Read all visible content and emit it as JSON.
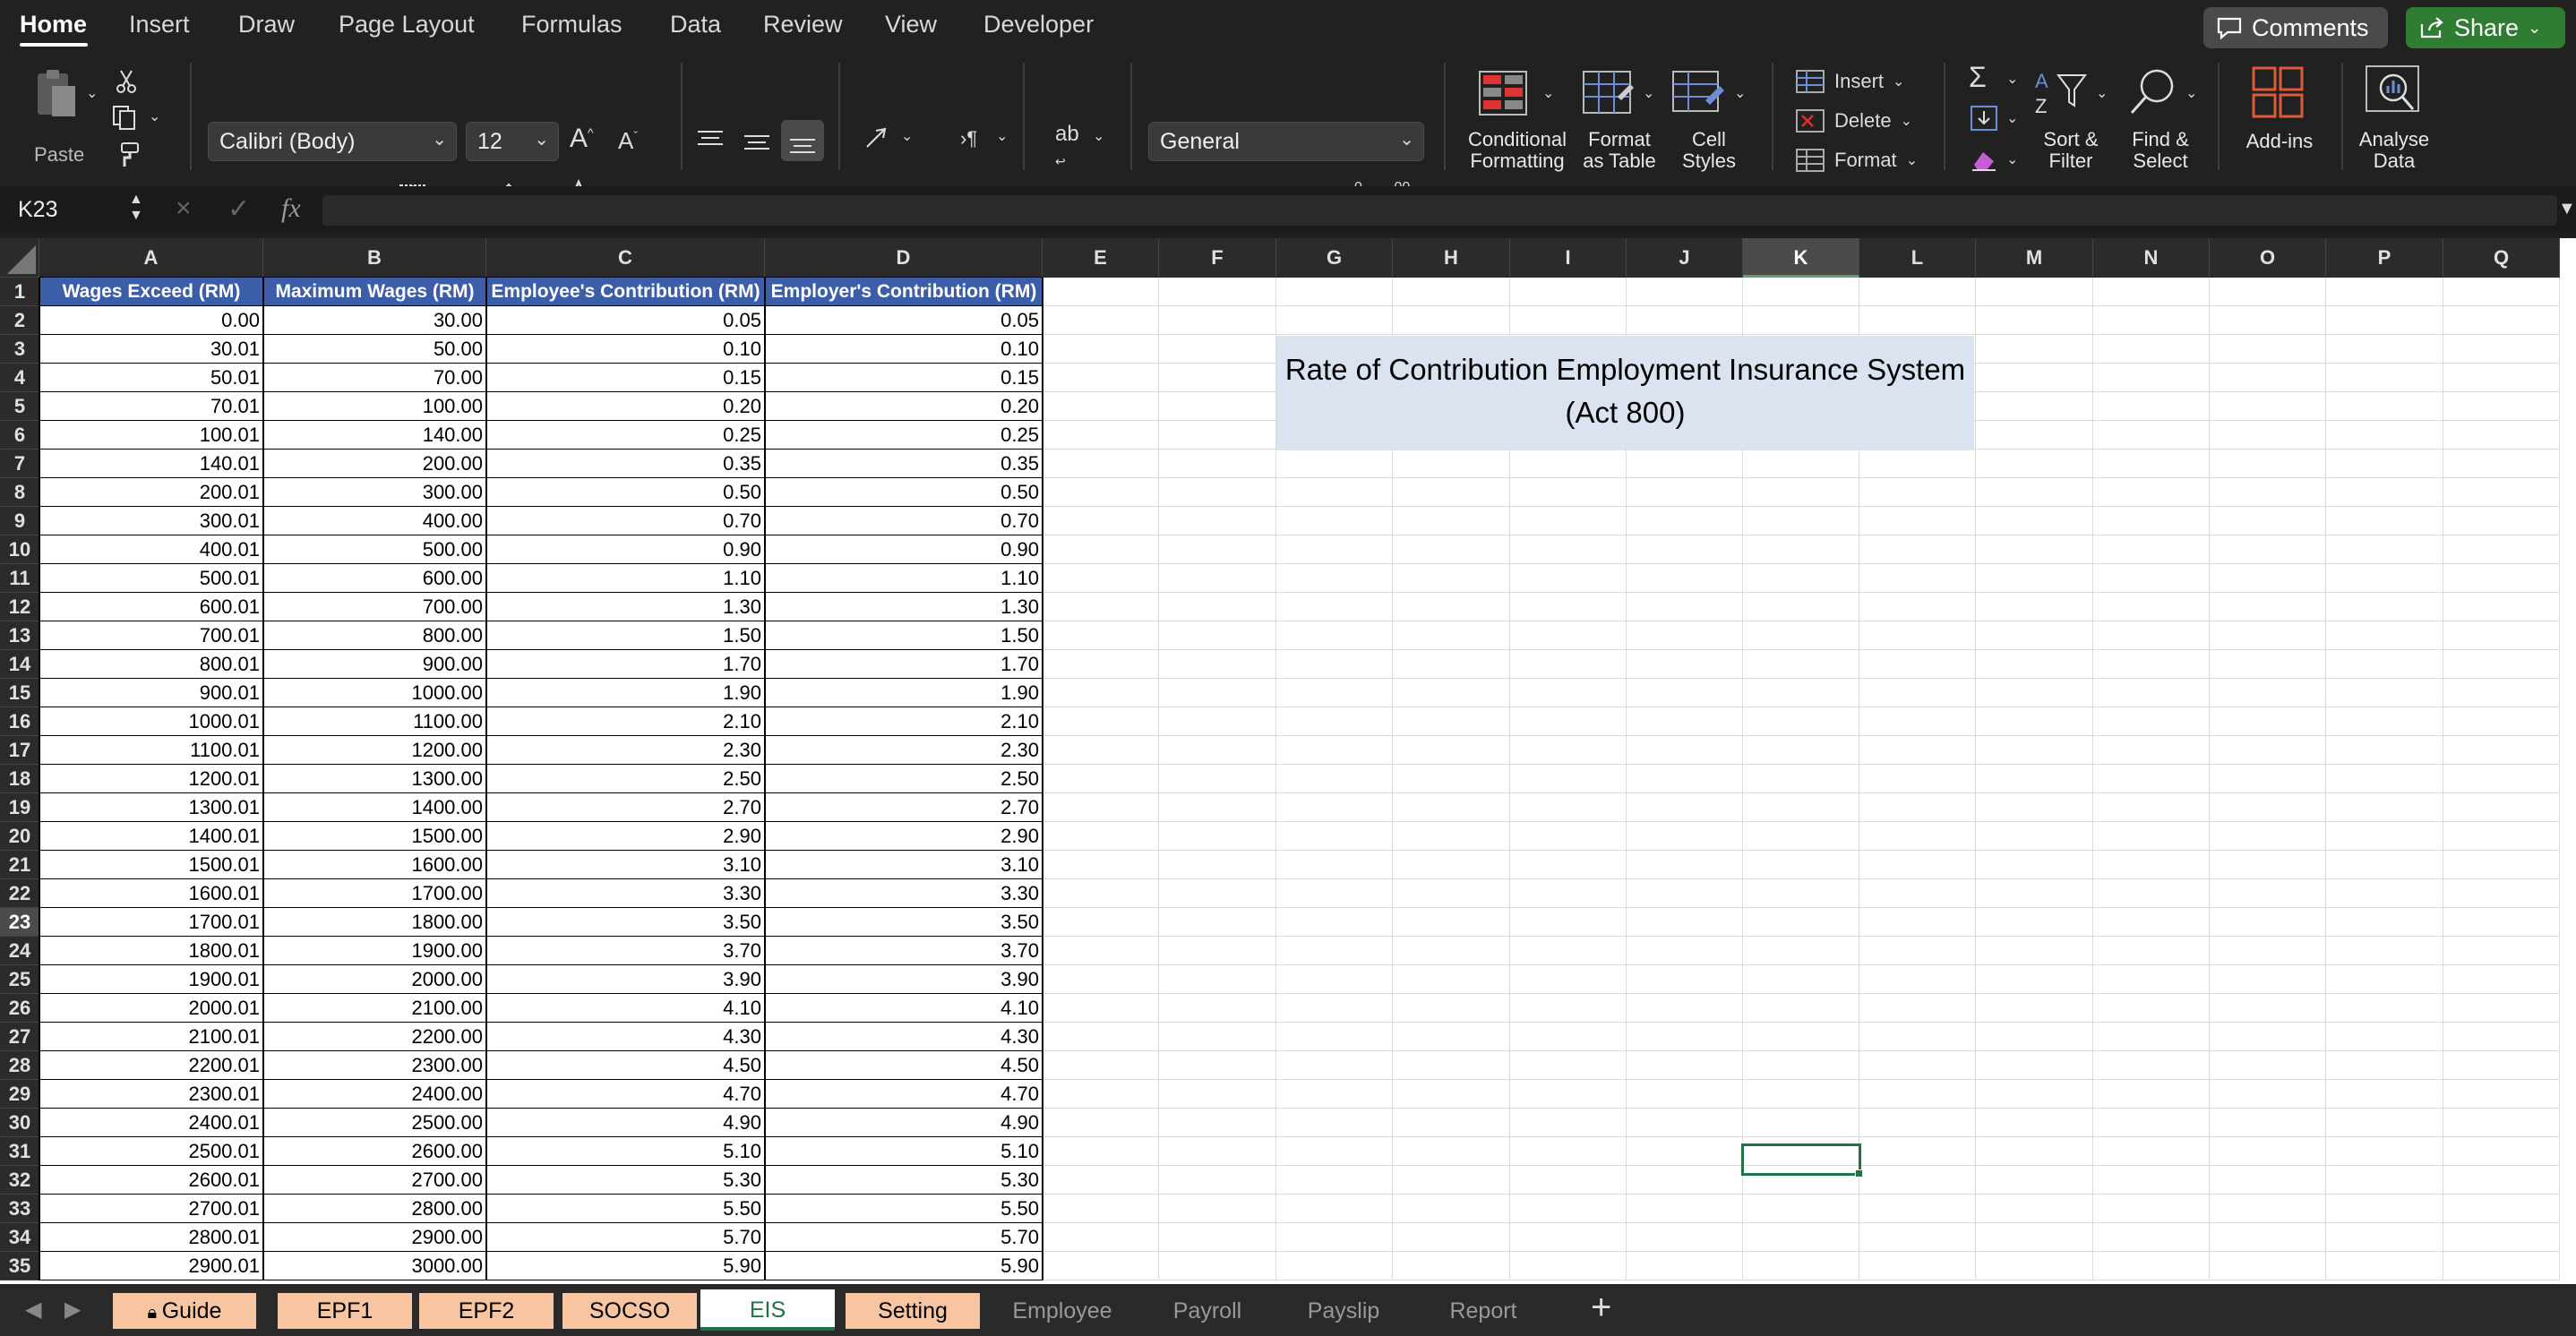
{
  "ribbon_tabs": [
    "Home",
    "Insert",
    "Draw",
    "Page Layout",
    "Formulas",
    "Data",
    "Review",
    "View",
    "Developer"
  ],
  "comments_label": "Comments",
  "share_label": "Share",
  "paste_label": "Paste",
  "font_name": "Calibri (Body)",
  "font_size": "12",
  "number_format": "General",
  "conditional_formatting": [
    "Conditional",
    "Formatting"
  ],
  "format_as_table": [
    "Format",
    "as Table"
  ],
  "cell_styles": [
    "Cell",
    "Styles"
  ],
  "insert_label": "Insert",
  "delete_label": "Delete",
  "format_label": "Format",
  "sort_filter": [
    "Sort &",
    "Filter"
  ],
  "find_select": [
    "Find &",
    "Select"
  ],
  "addins_label": "Add-ins",
  "analyse_data": [
    "Analyse",
    "Data"
  ],
  "name_box": "K23",
  "fx_label": "fx",
  "columns": [
    "A",
    "B",
    "C",
    "D",
    "E",
    "F",
    "G",
    "H",
    "I",
    "J",
    "K",
    "L",
    "M",
    "N",
    "O",
    "P",
    "Q"
  ],
  "selected_column": "K",
  "selected_row": 23,
  "table_headers": [
    "Wages Exceed (RM)",
    "Maximum Wages (RM)",
    "Employee's Contribution (RM)",
    "Employer's Contribution (RM)"
  ],
  "table_rows": [
    [
      "0.00",
      "30.00",
      "0.05",
      "0.05"
    ],
    [
      "30.01",
      "50.00",
      "0.10",
      "0.10"
    ],
    [
      "50.01",
      "70.00",
      "0.15",
      "0.15"
    ],
    [
      "70.01",
      "100.00",
      "0.20",
      "0.20"
    ],
    [
      "100.01",
      "140.00",
      "0.25",
      "0.25"
    ],
    [
      "140.01",
      "200.00",
      "0.35",
      "0.35"
    ],
    [
      "200.01",
      "300.00",
      "0.50",
      "0.50"
    ],
    [
      "300.01",
      "400.00",
      "0.70",
      "0.70"
    ],
    [
      "400.01",
      "500.00",
      "0.90",
      "0.90"
    ],
    [
      "500.01",
      "600.00",
      "1.10",
      "1.10"
    ],
    [
      "600.01",
      "700.00",
      "1.30",
      "1.30"
    ],
    [
      "700.01",
      "800.00",
      "1.50",
      "1.50"
    ],
    [
      "800.01",
      "900.00",
      "1.70",
      "1.70"
    ],
    [
      "900.01",
      "1000.00",
      "1.90",
      "1.90"
    ],
    [
      "1000.01",
      "1100.00",
      "2.10",
      "2.10"
    ],
    [
      "1100.01",
      "1200.00",
      "2.30",
      "2.30"
    ],
    [
      "1200.01",
      "1300.00",
      "2.50",
      "2.50"
    ],
    [
      "1300.01",
      "1400.00",
      "2.70",
      "2.70"
    ],
    [
      "1400.01",
      "1500.00",
      "2.90",
      "2.90"
    ],
    [
      "1500.01",
      "1600.00",
      "3.10",
      "3.10"
    ],
    [
      "1600.01",
      "1700.00",
      "3.30",
      "3.30"
    ],
    [
      "1700.01",
      "1800.00",
      "3.50",
      "3.50"
    ],
    [
      "1800.01",
      "1900.00",
      "3.70",
      "3.70"
    ],
    [
      "1900.01",
      "2000.00",
      "3.90",
      "3.90"
    ],
    [
      "2000.01",
      "2100.00",
      "4.10",
      "4.10"
    ],
    [
      "2100.01",
      "2200.00",
      "4.30",
      "4.30"
    ],
    [
      "2200.01",
      "2300.00",
      "4.50",
      "4.50"
    ],
    [
      "2300.01",
      "2400.00",
      "4.70",
      "4.70"
    ],
    [
      "2400.01",
      "2500.00",
      "4.90",
      "4.90"
    ],
    [
      "2500.01",
      "2600.00",
      "5.10",
      "5.10"
    ],
    [
      "2600.01",
      "2700.00",
      "5.30",
      "5.30"
    ],
    [
      "2700.01",
      "2800.00",
      "5.50",
      "5.50"
    ],
    [
      "2800.01",
      "2900.00",
      "5.70",
      "5.70"
    ],
    [
      "2900.01",
      "3000.00",
      "5.90",
      "5.90"
    ]
  ],
  "title_box": {
    "line1": "Rate of Contribution Employment Insurance System",
    "line2": "(Act 800)"
  },
  "sheet_tabs": [
    {
      "label": "Guide",
      "style": "orange",
      "lock": true
    },
    {
      "label": "EPF1",
      "style": "orange"
    },
    {
      "label": "EPF2",
      "style": "orange"
    },
    {
      "label": "SOCSO",
      "style": "orange"
    },
    {
      "label": "EIS",
      "style": "active"
    },
    {
      "label": "Setting",
      "style": "orange"
    },
    {
      "label": "Employee",
      "style": "plain"
    },
    {
      "label": "Payroll",
      "style": "plain"
    },
    {
      "label": "Payslip",
      "style": "plain"
    },
    {
      "label": "Report",
      "style": "plain"
    }
  ],
  "add_sheet_label": "+",
  "colors": {
    "header_blue": "#3c5ea8",
    "title_box_bg": "#dce3f0",
    "orange_tab": "#f7c59f",
    "share_green": "#2e7d32",
    "selection_green": "#217346"
  }
}
